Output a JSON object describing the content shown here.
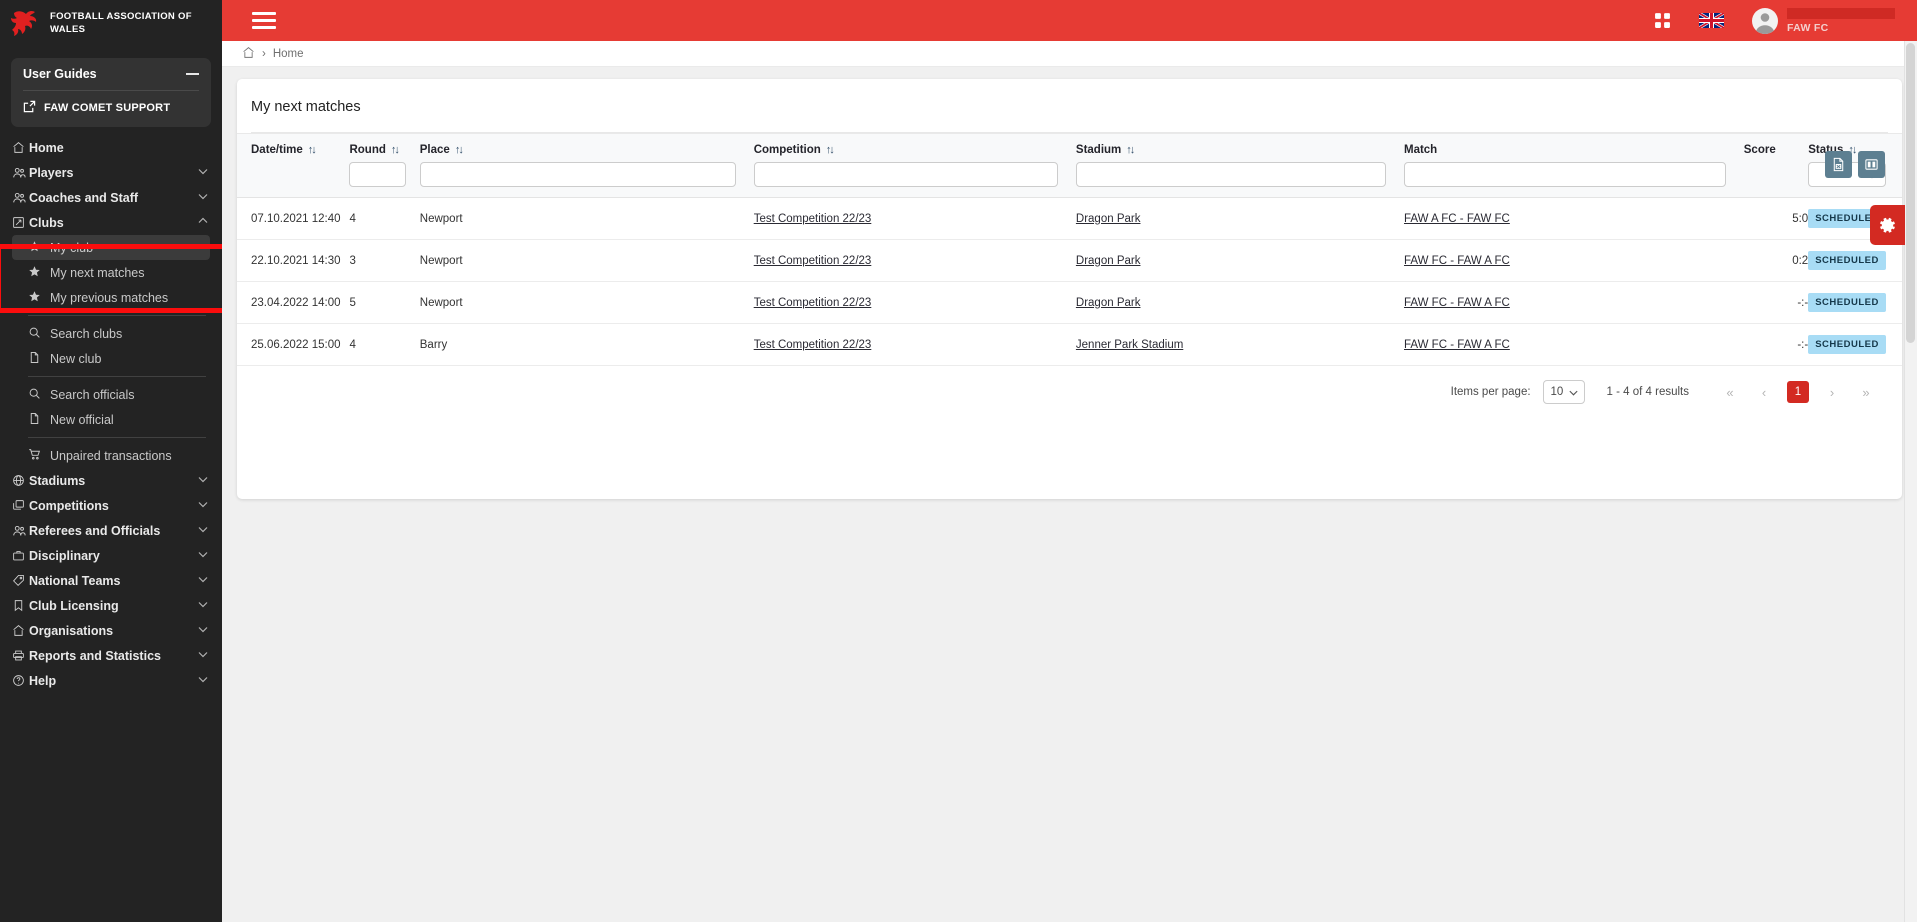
{
  "brand": {
    "name": "FOOTBALL ASSOCIATION OF WALES",
    "crest_icon": "faw-dragon-crest"
  },
  "sidebar": {
    "guides": {
      "title": "User Guides",
      "collapse_icon": "minus-icon",
      "support_label": "FAW COMET SUPPORT",
      "support_icon": "external-link-icon"
    },
    "items": [
      {
        "label": "Home",
        "icon": "home-icon",
        "expandable": false
      },
      {
        "label": "Players",
        "icon": "people-icon",
        "expandable": true,
        "expanded": false
      },
      {
        "label": "Coaches and Staff",
        "icon": "people-icon",
        "expandable": true,
        "expanded": false
      },
      {
        "label": "Clubs",
        "icon": "club-badge-icon",
        "expandable": true,
        "expanded": true
      },
      {
        "label": "Stadiums",
        "icon": "globe-icon",
        "expandable": true,
        "expanded": false
      },
      {
        "label": "Competitions",
        "icon": "layers-icon",
        "expandable": true,
        "expanded": false
      },
      {
        "label": "Referees and Officials",
        "icon": "people-icon",
        "expandable": true,
        "expanded": false
      },
      {
        "label": "Disciplinary",
        "icon": "briefcase-icon",
        "expandable": true,
        "expanded": false
      },
      {
        "label": "National Teams",
        "icon": "tag-icon",
        "expandable": true,
        "expanded": false
      },
      {
        "label": "Club Licensing",
        "icon": "bookmark-icon",
        "expandable": true,
        "expanded": false
      },
      {
        "label": "Organisations",
        "icon": "home-icon",
        "expandable": true,
        "expanded": false
      },
      {
        "label": "Reports and Statistics",
        "icon": "printer-icon",
        "expandable": true,
        "expanded": false
      },
      {
        "label": "Help",
        "icon": "question-circle-icon",
        "expandable": true,
        "expanded": false
      }
    ],
    "clubs_submenu": [
      {
        "label": "My club",
        "icon": "star-icon",
        "active": true
      },
      {
        "label": "My next matches",
        "icon": "star-icon",
        "active": false
      },
      {
        "label": "My previous matches",
        "icon": "star-icon",
        "active": false
      },
      {
        "divider": true
      },
      {
        "label": "Search clubs",
        "icon": "search-icon",
        "active": false
      },
      {
        "label": "New club",
        "icon": "document-icon",
        "active": false
      },
      {
        "divider": true
      },
      {
        "label": "Search officials",
        "icon": "search-icon",
        "active": false
      },
      {
        "label": "New official",
        "icon": "document-icon",
        "active": false
      },
      {
        "divider": true
      },
      {
        "label": "Unpaired transactions",
        "icon": "cart-icon",
        "active": false
      }
    ],
    "highlight": {
      "color": "#fb0d0d",
      "targets": [
        "Clubs",
        "My club"
      ]
    }
  },
  "topbar": {
    "menu_icon": "hamburger-menu-icon",
    "apps_icon": "grid-apps-icon",
    "language_icon": "uk-flag-icon",
    "avatar_icon": "user-avatar-icon",
    "org_name": "FAW FC",
    "accent_color": "#e63b34"
  },
  "breadcrumb": {
    "home_icon": "home-icon",
    "separator": "›",
    "current": "Home"
  },
  "card": {
    "title": "My next matches",
    "tools": [
      {
        "name": "export-excel-button",
        "icon": "excel-file-icon"
      },
      {
        "name": "column-chooser-button",
        "icon": "columns-icon"
      }
    ]
  },
  "table": {
    "columns": [
      {
        "key": "datetime",
        "label": "Date/time",
        "sortable": true,
        "filter": "none"
      },
      {
        "key": "round",
        "label": "Round",
        "sortable": true,
        "filter": "text"
      },
      {
        "key": "place",
        "label": "Place",
        "sortable": true,
        "filter": "text"
      },
      {
        "key": "competition",
        "label": "Competition",
        "sortable": true,
        "filter": "text"
      },
      {
        "key": "stadium",
        "label": "Stadium",
        "sortable": true,
        "filter": "text"
      },
      {
        "key": "match",
        "label": "Match",
        "sortable": true,
        "filter": "text"
      },
      {
        "key": "score",
        "label": "Score",
        "sortable": false,
        "filter": "none"
      },
      {
        "key": "status",
        "label": "Status",
        "sortable": true,
        "filter": "select"
      }
    ],
    "sort_icon": "sort-arrows-icon",
    "filter_values": {
      "round": "",
      "place": "",
      "competition": "",
      "stadium": "",
      "match": "",
      "status": ""
    },
    "rows": [
      {
        "datetime": "07.10.2021 12:40",
        "round": "4",
        "place": "Newport",
        "competition": "Test Competition 22/23",
        "stadium": "Dragon Park",
        "match": "FAW A FC - FAW FC",
        "score": "5:0",
        "status": "SCHEDULED"
      },
      {
        "datetime": "22.10.2021 14:30",
        "round": "3",
        "place": "Newport",
        "competition": "Test Competition 22/23",
        "stadium": "Dragon Park",
        "match": "FAW FC - FAW A FC",
        "score": "0:2",
        "status": "SCHEDULED"
      },
      {
        "datetime": "23.04.2022 14:00",
        "round": "5",
        "place": "Newport",
        "competition": "Test Competition 22/23",
        "stadium": "Dragon Park",
        "match": "FAW FC - FAW A FC",
        "score": "-:-",
        "status": "SCHEDULED"
      },
      {
        "datetime": "25.06.2022 15:00",
        "round": "4",
        "place": "Barry",
        "competition": "Test Competition 22/23",
        "stadium": "Jenner Park Stadium",
        "match": "FAW FC - FAW A FC",
        "score": "-:-",
        "status": "SCHEDULED"
      }
    ],
    "status_pill_color": "#a8dcf5"
  },
  "pagination": {
    "items_per_page_label": "Items per page:",
    "items_per_page_value": "10",
    "results_text": "1 - 4 of 4 results",
    "first_icon": "«",
    "prev_icon": "‹",
    "next_icon": "›",
    "last_icon": "»",
    "current_page": "1",
    "active_color": "#d32a22"
  },
  "settings_tab": {
    "icon": "gear-icon",
    "color": "#d32a22"
  }
}
